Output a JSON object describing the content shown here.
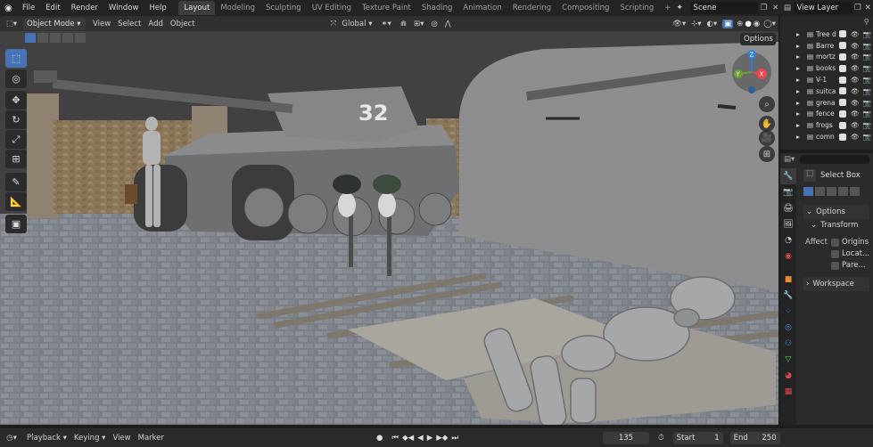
{
  "topbar": {
    "menus": [
      "File",
      "Edit",
      "Render",
      "Window",
      "Help"
    ],
    "workspaces": [
      "Layout",
      "Modeling",
      "Sculpting",
      "UV Editing",
      "Texture Paint",
      "Shading",
      "Animation",
      "Rendering",
      "Compositing",
      "Scripting"
    ],
    "active_workspace": "Layout",
    "add_workspace": "+",
    "scene": "Scene",
    "view_layer": "View Layer"
  },
  "header3d": {
    "mode": "Object Mode",
    "menus": [
      "View",
      "Select",
      "Add",
      "Object"
    ],
    "orientation": "Global",
    "options": "Options"
  },
  "scene_render": {
    "tank_number": "32"
  },
  "gizmo": {
    "x": "X",
    "y": "Y",
    "z": "Z"
  },
  "outliner": {
    "items": [
      "Tree d",
      "Barre",
      "mortz",
      "books",
      "V-1",
      "suitca",
      "grena",
      "fence",
      "frogs",
      "comn"
    ]
  },
  "properties": {
    "tool_name": "Select Box",
    "options_label": "Options",
    "transform_label": "Transform",
    "affect_label": "Affect",
    "affect_options": [
      "Origins",
      "Locat...",
      "Pare..."
    ],
    "workspace_label": "Workspace"
  },
  "timeline": {
    "menus": [
      "Playback",
      "Keying",
      "View",
      "Marker"
    ],
    "current_frame": "135",
    "start_label": "Start",
    "start_value": "1",
    "end_label": "End",
    "end_value": "250"
  },
  "colors": {
    "accent": "#4772b3",
    "active_tool": "#4772b3",
    "x_axis": "#e5484d",
    "y_axis": "#6ba132",
    "z_axis": "#2f7fd8"
  }
}
